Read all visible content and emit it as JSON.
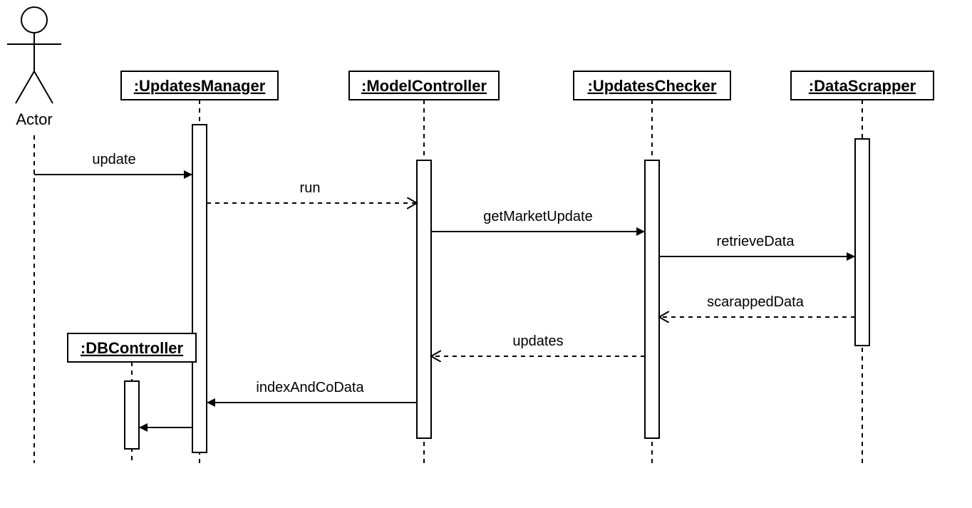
{
  "diagram_type": "UML Sequence Diagram",
  "actor": {
    "name": "Actor"
  },
  "participants": {
    "updatesManager": ":UpdatesManager",
    "modelController": ":ModelController",
    "updatesChecker": ":UpdatesChecker",
    "dataScrapper": ":DataScrapper",
    "dbController": ":DBController"
  },
  "messages": {
    "m1": "update",
    "m2": "run",
    "m3": "getMarketUpdate",
    "m4": "retrieveData",
    "m5": "scarappedData",
    "m6": "updates",
    "m7": "indexAndCoData"
  }
}
